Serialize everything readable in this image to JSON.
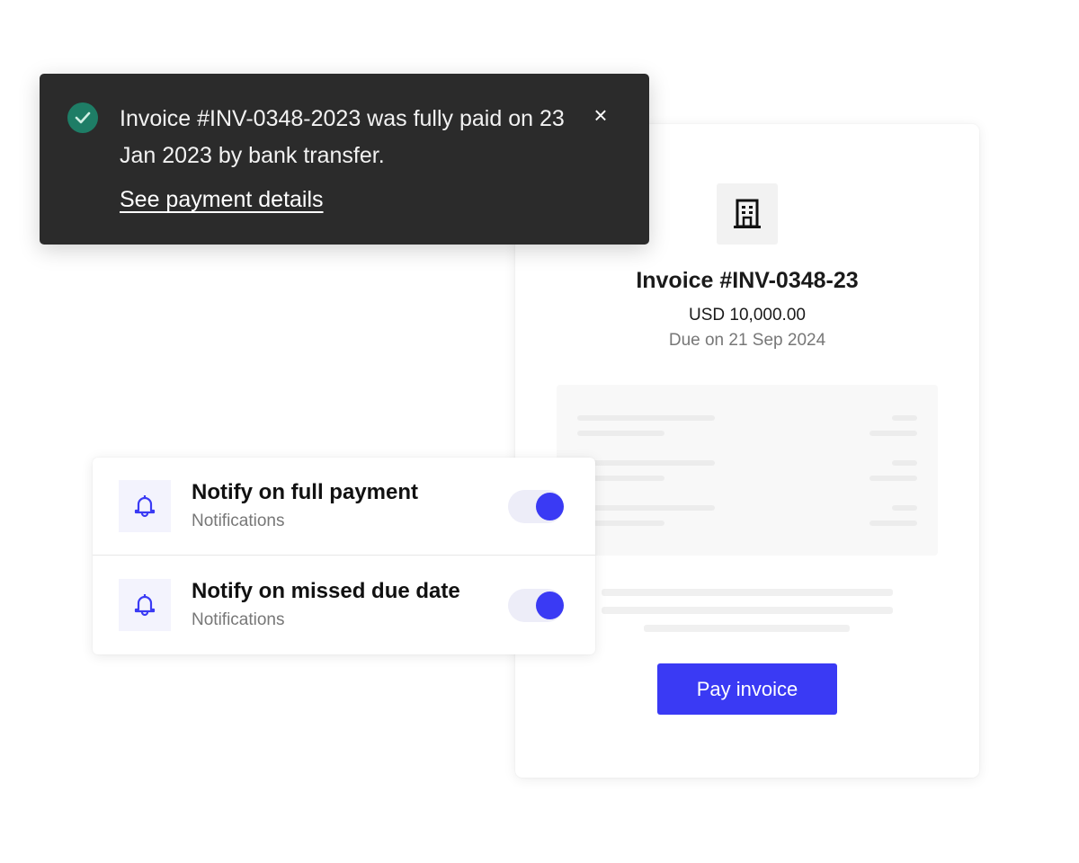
{
  "toast": {
    "message": "Invoice #INV-0348-2023 was fully paid on 23 Jan 2023 by bank transfer.",
    "link_label": "See payment details",
    "close_label": "×",
    "status_icon": "check-circle-icon",
    "status_color": "#1e7d66"
  },
  "invoice": {
    "icon": "building-icon",
    "title": "Invoice #INV-0348-23",
    "amount": "USD 10,000.00",
    "due": "Due on 21 Sep 2024",
    "pay_button_label": "Pay invoice",
    "accent_color": "#3a3af4"
  },
  "notifications": [
    {
      "title": "Notify on full payment",
      "subtitle": "Notifications",
      "icon": "bell-icon",
      "enabled": true
    },
    {
      "title": "Notify on missed due date",
      "subtitle": "Notifications",
      "icon": "bell-icon",
      "enabled": true
    }
  ]
}
